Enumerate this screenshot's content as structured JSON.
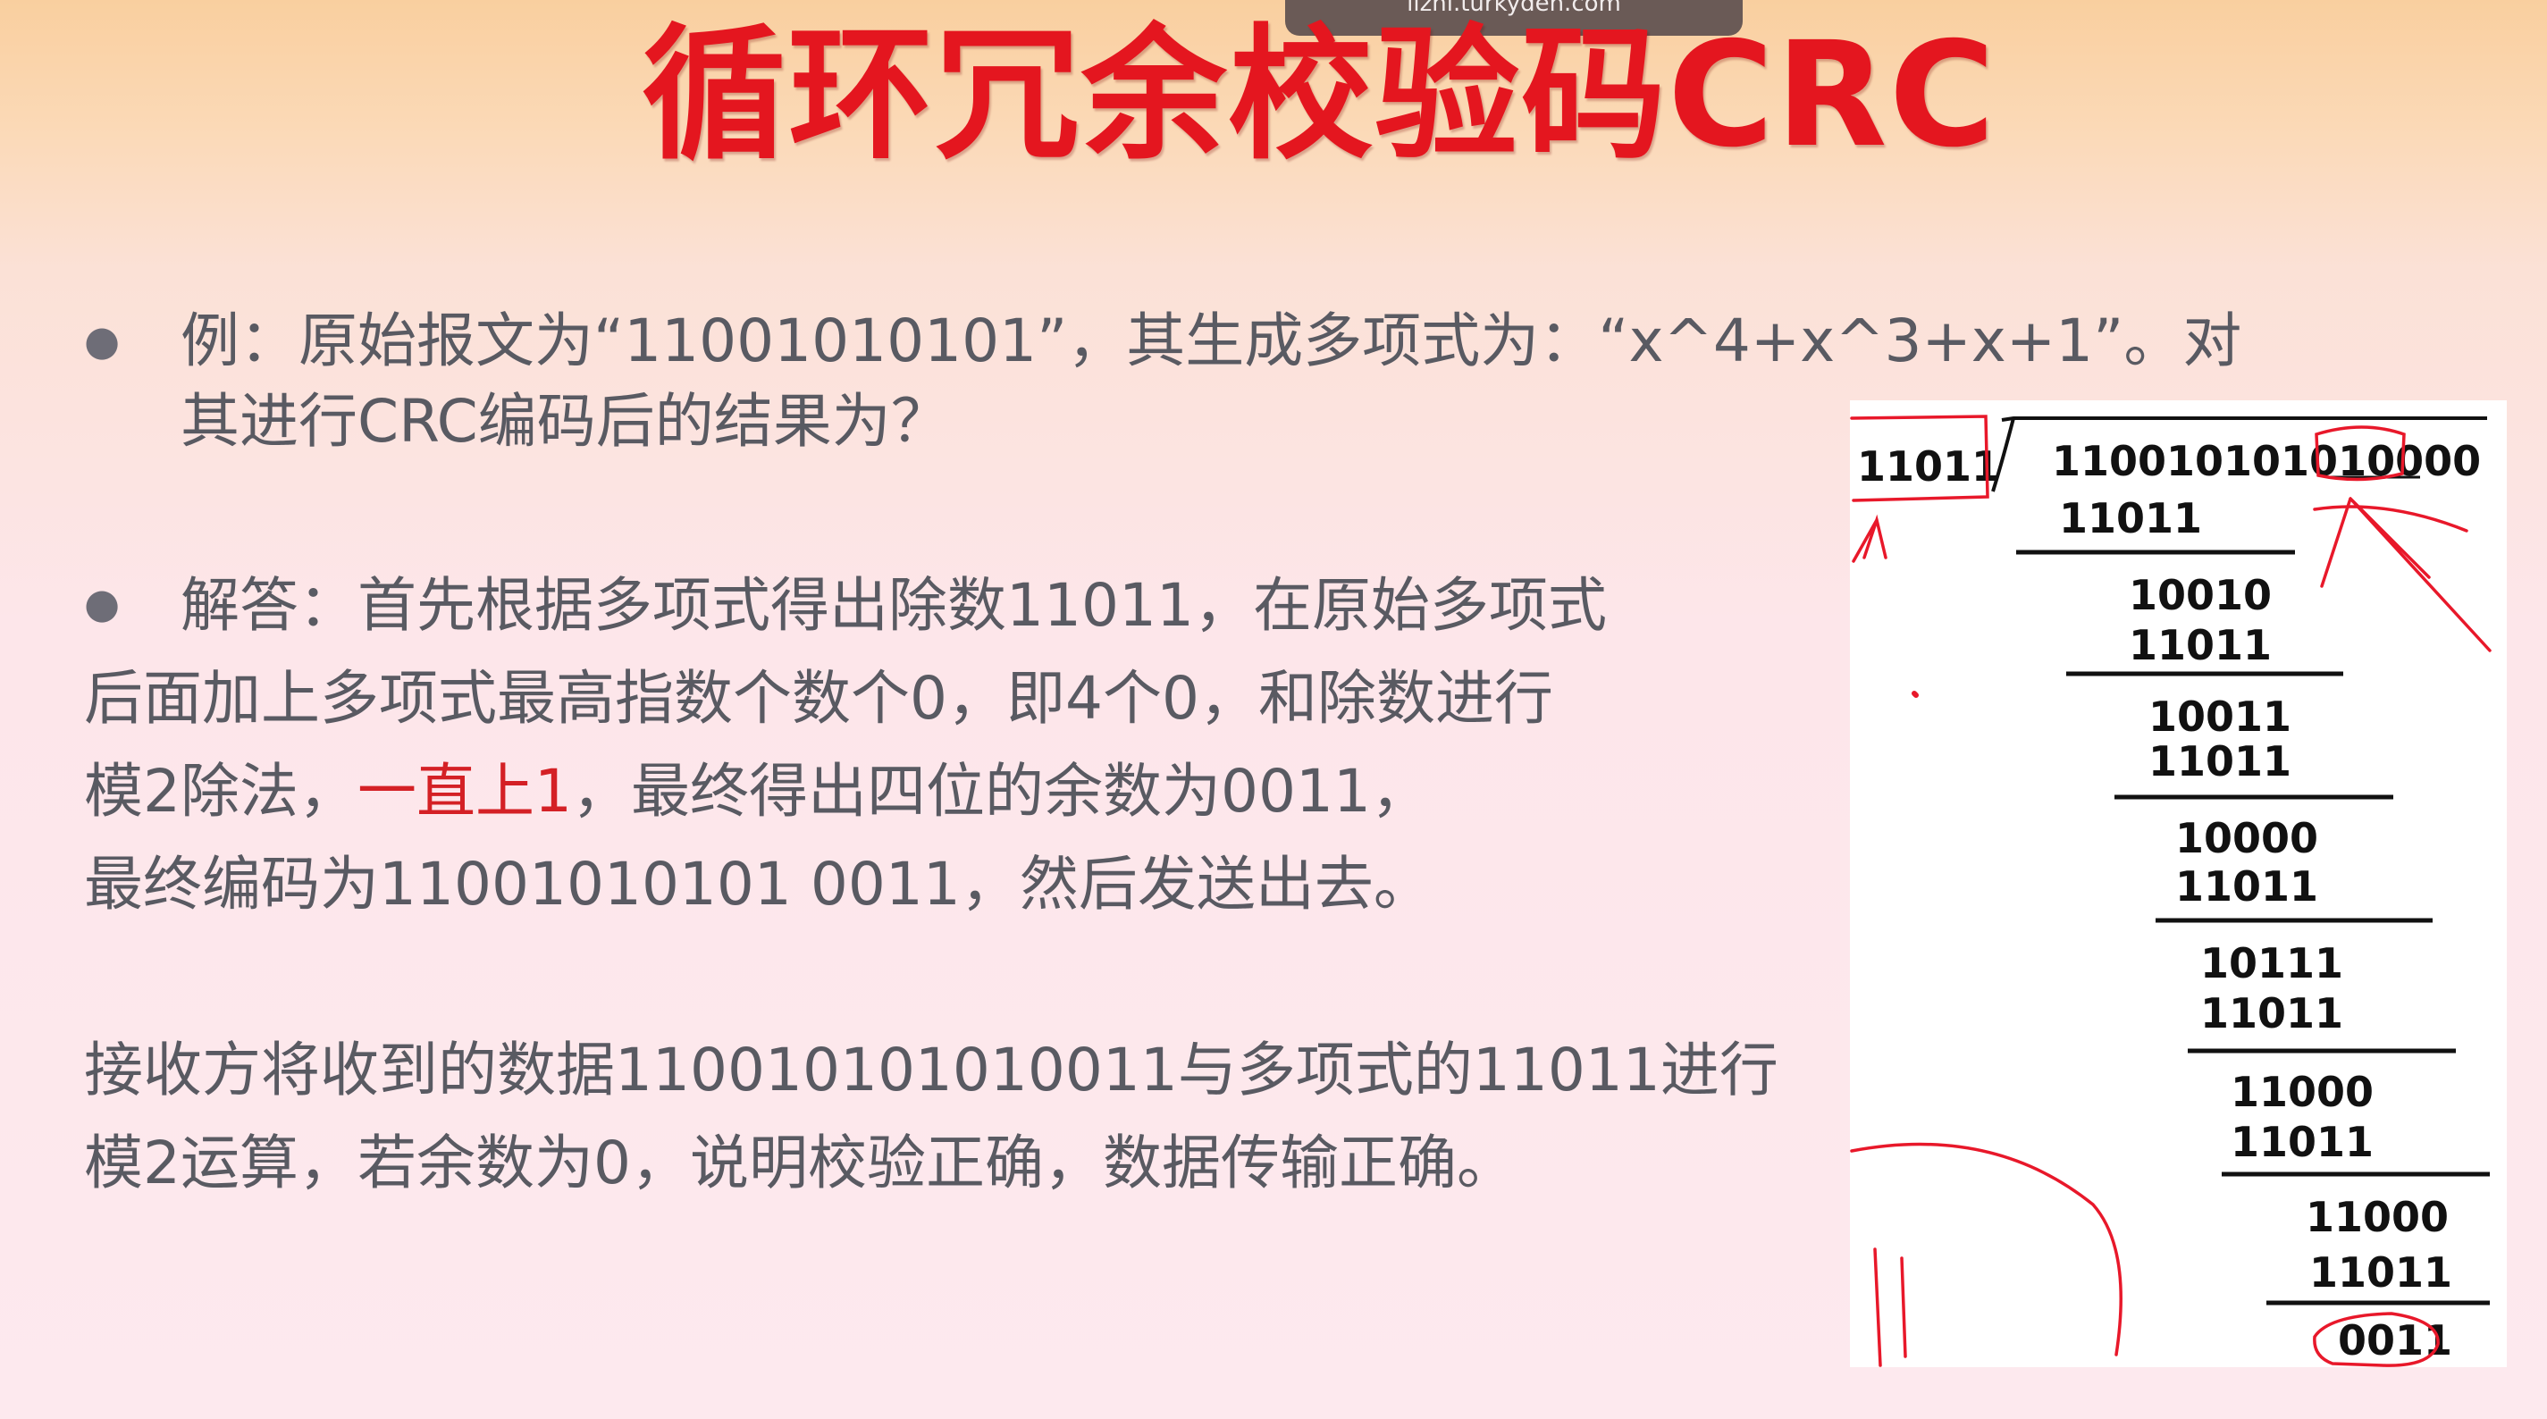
{
  "overlay": {
    "url": "lizhi.turkyden.com"
  },
  "slide": {
    "title": "循环冗余校验码CRC",
    "example": {
      "line1": "例：原始报文为“11001010101”，其生成多项式为：“x^4+x^3+x+1”。对",
      "line2": "其进行CRC编码后的结果为？"
    },
    "answer": {
      "line1": "解答：首先根据多项式得出除数11011，在原始多项式",
      "line2": "后面加上多项式最高指数个数个0，即4个0，和除数进行",
      "line3_part1": "模2除法，",
      "line3_red": "一直上1",
      "line3_part2": "，最终得出四位的余数为0011，",
      "line4": "最终编码为11001010101 0011，然后发送出去。"
    },
    "receiver": {
      "line1": "接收方将收到的数据110010101010011与多项式的11011进行",
      "line2": "模2运算，若余数为0，说明校验正确，数据传输正确。"
    }
  },
  "division": {
    "divisor": "11011",
    "dividend_prefix": "1100101010",
    "dividend_boxed": "1",
    "dividend_suffix": "0000",
    "steps": [
      "11011",
      "10010",
      "11011",
      "10011",
      "11011",
      "10000",
      "11011",
      "10111",
      "11011",
      "11000",
      "11011",
      "11000",
      "11011"
    ],
    "remainder": "0011"
  },
  "colors": {
    "title": "#e4161f",
    "emphasis": "#d42025",
    "body_text": "#595a62",
    "ink": "#e8182a"
  }
}
